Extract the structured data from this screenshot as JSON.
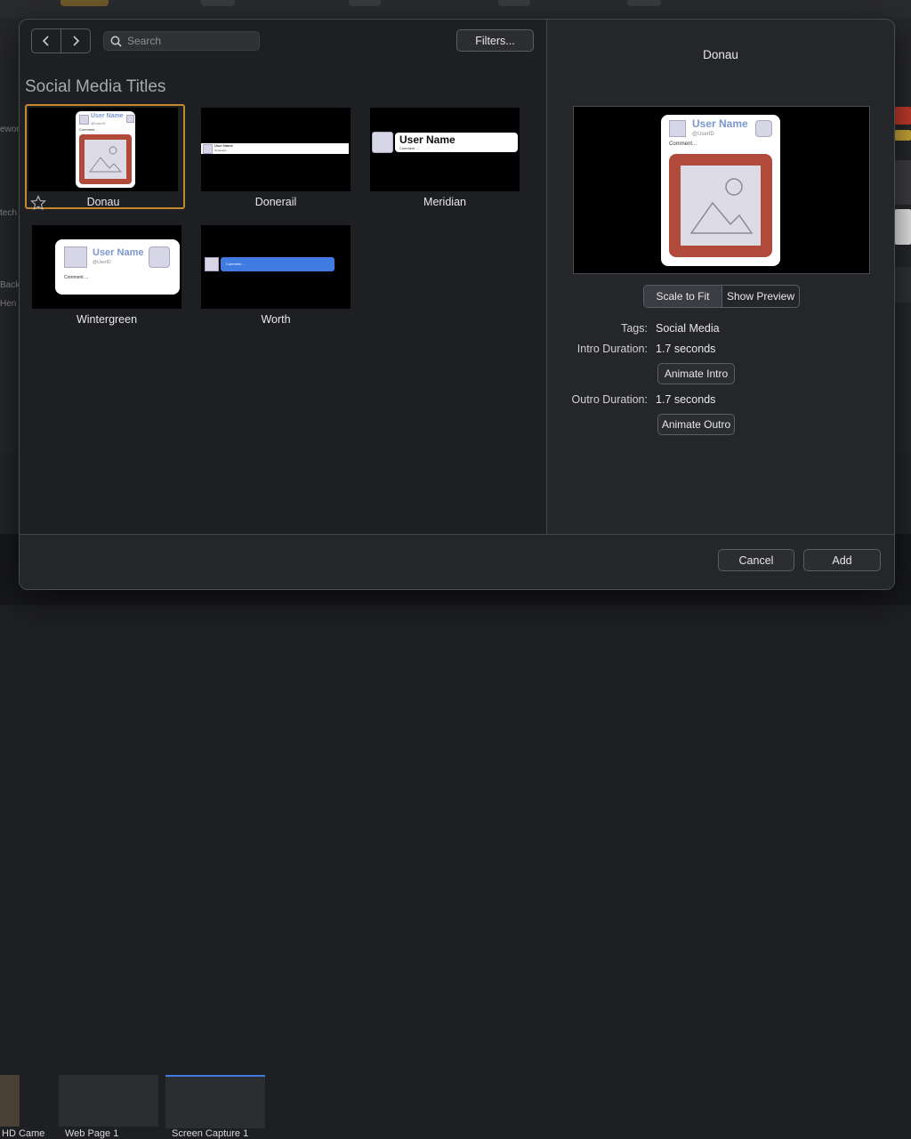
{
  "background_app": {
    "left_snippets": [
      "ework",
      "tech",
      "Backgr",
      "Hen ne"
    ],
    "bottom_labels": [
      "HD Came",
      "Web Page 1",
      "Screen Capture 1"
    ]
  },
  "nav": {
    "back_icon": "chevron-left-icon",
    "forward_icon": "chevron-right-icon"
  },
  "search": {
    "placeholder": "Search",
    "value": ""
  },
  "filters_label": "Filters...",
  "section_title": "Social Media Titles",
  "templates": [
    {
      "name": "Donau",
      "selected": true,
      "favorite_icon": "star-outline-icon"
    },
    {
      "name": "Donerail",
      "selected": false
    },
    {
      "name": "Meridian",
      "selected": false
    },
    {
      "name": "Wintergreen",
      "selected": false
    },
    {
      "name": "Worth",
      "selected": false
    }
  ],
  "thumb_text": {
    "user_name": "User Name",
    "user_id": "@UserID",
    "comment": "Comment...",
    "comment_alt": "Comment ..."
  },
  "preview": {
    "title": "Donau",
    "card": {
      "user_name": "User Name",
      "user_id": "@UserID",
      "comment": "Comment..."
    },
    "scale_to_fit_label": "Scale to Fit",
    "show_preview_label": "Show Preview",
    "active_mode": "Scale to Fit"
  },
  "properties": {
    "tags_label": "Tags:",
    "tags_value": "Social Media",
    "intro_label": "Intro Duration:",
    "intro_value": "1.7 seconds",
    "animate_intro_label": "Animate Intro",
    "outro_label": "Outro Duration:",
    "outro_value": "1.7 seconds",
    "animate_outro_label": "Animate Outro"
  },
  "footer": {
    "cancel_label": "Cancel",
    "add_label": "Add"
  },
  "colors": {
    "selection_outline": "#c08a2b",
    "username_blue": "#7a97cf",
    "image_frame_red": "#b04a3a",
    "worth_bar_blue": "#3f7be0"
  }
}
